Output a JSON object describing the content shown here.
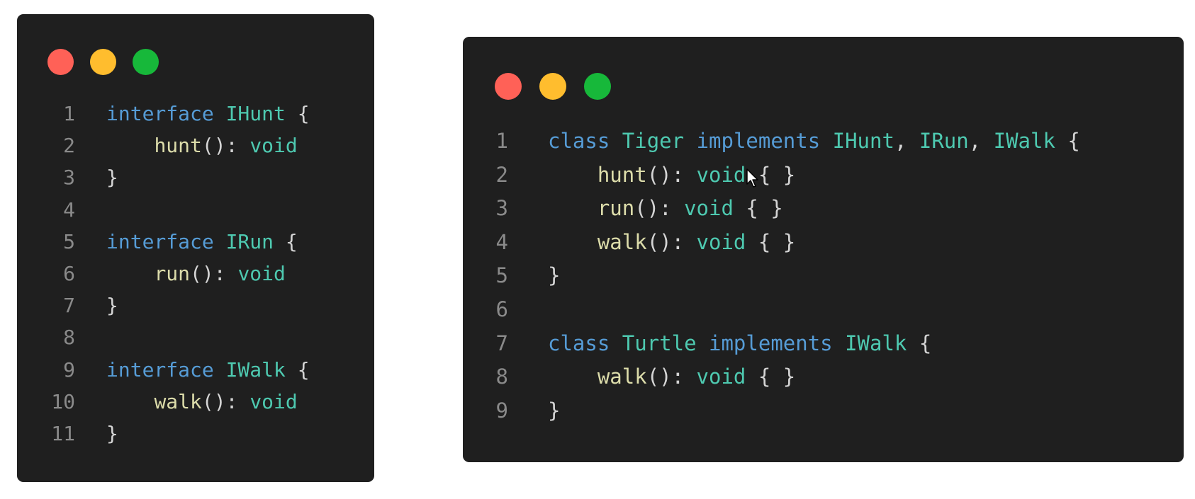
{
  "colors": {
    "window_bg": "#1f1f1f",
    "dot_red": "#ff6157",
    "dot_yellow": "#ffbd2e",
    "dot_green": "#17b83a",
    "line_number": "#8a8a8a",
    "keyword": "#569cd6",
    "type": "#4ec9b0",
    "method": "#dcdcaa",
    "punct": "#d4d4d4"
  },
  "windows": [
    {
      "id": "left",
      "name": "interfaces-code-window",
      "dots": [
        "close",
        "minimize",
        "maximize"
      ],
      "lines": [
        {
          "n": "1",
          "tokens": [
            {
              "t": "interface",
              "k": "keyword"
            },
            {
              "t": " ",
              "k": "punct"
            },
            {
              "t": "IHunt",
              "k": "type"
            },
            {
              "t": " {",
              "k": "punct"
            }
          ]
        },
        {
          "n": "2",
          "tokens": [
            {
              "t": "    ",
              "k": "punct"
            },
            {
              "t": "hunt",
              "k": "method"
            },
            {
              "t": "(): ",
              "k": "punct"
            },
            {
              "t": "void",
              "k": "type"
            }
          ]
        },
        {
          "n": "3",
          "tokens": [
            {
              "t": "}",
              "k": "punct"
            }
          ]
        },
        {
          "n": "4",
          "tokens": []
        },
        {
          "n": "5",
          "tokens": [
            {
              "t": "interface",
              "k": "keyword"
            },
            {
              "t": " ",
              "k": "punct"
            },
            {
              "t": "IRun",
              "k": "type"
            },
            {
              "t": " {",
              "k": "punct"
            }
          ]
        },
        {
          "n": "6",
          "tokens": [
            {
              "t": "    ",
              "k": "punct"
            },
            {
              "t": "run",
              "k": "method"
            },
            {
              "t": "(): ",
              "k": "punct"
            },
            {
              "t": "void",
              "k": "type"
            }
          ]
        },
        {
          "n": "7",
          "tokens": [
            {
              "t": "}",
              "k": "punct"
            }
          ]
        },
        {
          "n": "8",
          "tokens": []
        },
        {
          "n": "9",
          "tokens": [
            {
              "t": "interface",
              "k": "keyword"
            },
            {
              "t": " ",
              "k": "punct"
            },
            {
              "t": "IWalk",
              "k": "type"
            },
            {
              "t": " {",
              "k": "punct"
            }
          ]
        },
        {
          "n": "10",
          "tokens": [
            {
              "t": "    ",
              "k": "punct"
            },
            {
              "t": "walk",
              "k": "method"
            },
            {
              "t": "(): ",
              "k": "punct"
            },
            {
              "t": "void",
              "k": "type"
            }
          ]
        },
        {
          "n": "11",
          "tokens": [
            {
              "t": "}",
              "k": "punct"
            }
          ]
        }
      ]
    },
    {
      "id": "right",
      "name": "classes-code-window",
      "dots": [
        "close",
        "minimize",
        "maximize"
      ],
      "lines": [
        {
          "n": "1",
          "tokens": [
            {
              "t": "class",
              "k": "keyword"
            },
            {
              "t": " ",
              "k": "punct"
            },
            {
              "t": "Tiger",
              "k": "type"
            },
            {
              "t": " ",
              "k": "punct"
            },
            {
              "t": "implements",
              "k": "keyword"
            },
            {
              "t": " ",
              "k": "punct"
            },
            {
              "t": "IHunt",
              "k": "type"
            },
            {
              "t": ", ",
              "k": "punct"
            },
            {
              "t": "IRun",
              "k": "type"
            },
            {
              "t": ", ",
              "k": "punct"
            },
            {
              "t": "IWalk",
              "k": "type"
            },
            {
              "t": " {",
              "k": "punct"
            }
          ]
        },
        {
          "n": "2",
          "tokens": [
            {
              "t": "    ",
              "k": "punct"
            },
            {
              "t": "hunt",
              "k": "method"
            },
            {
              "t": "(): ",
              "k": "punct"
            },
            {
              "t": "void",
              "k": "type"
            },
            {
              "t": " { }",
              "k": "punct"
            }
          ]
        },
        {
          "n": "3",
          "tokens": [
            {
              "t": "    ",
              "k": "punct"
            },
            {
              "t": "run",
              "k": "method"
            },
            {
              "t": "(): ",
              "k": "punct"
            },
            {
              "t": "void",
              "k": "type"
            },
            {
              "t": " { }",
              "k": "punct"
            }
          ]
        },
        {
          "n": "4",
          "tokens": [
            {
              "t": "    ",
              "k": "punct"
            },
            {
              "t": "walk",
              "k": "method"
            },
            {
              "t": "(): ",
              "k": "punct"
            },
            {
              "t": "void",
              "k": "type"
            },
            {
              "t": " { }",
              "k": "punct"
            }
          ]
        },
        {
          "n": "5",
          "tokens": [
            {
              "t": "}",
              "k": "punct"
            }
          ]
        },
        {
          "n": "6",
          "tokens": []
        },
        {
          "n": "7",
          "tokens": [
            {
              "t": "class",
              "k": "keyword"
            },
            {
              "t": " ",
              "k": "punct"
            },
            {
              "t": "Turtle",
              "k": "type"
            },
            {
              "t": " ",
              "k": "punct"
            },
            {
              "t": "implements",
              "k": "keyword"
            },
            {
              "t": " ",
              "k": "punct"
            },
            {
              "t": "IWalk",
              "k": "type"
            },
            {
              "t": " {",
              "k": "punct"
            }
          ]
        },
        {
          "n": "8",
          "tokens": [
            {
              "t": "    ",
              "k": "punct"
            },
            {
              "t": "walk",
              "k": "method"
            },
            {
              "t": "(): ",
              "k": "punct"
            },
            {
              "t": "void",
              "k": "type"
            },
            {
              "t": " { }",
              "k": "punct"
            }
          ]
        },
        {
          "n": "9",
          "tokens": [
            {
              "t": "}",
              "k": "punct"
            }
          ]
        }
      ]
    }
  ],
  "cursor": {
    "icon": "mouse-pointer-icon"
  }
}
